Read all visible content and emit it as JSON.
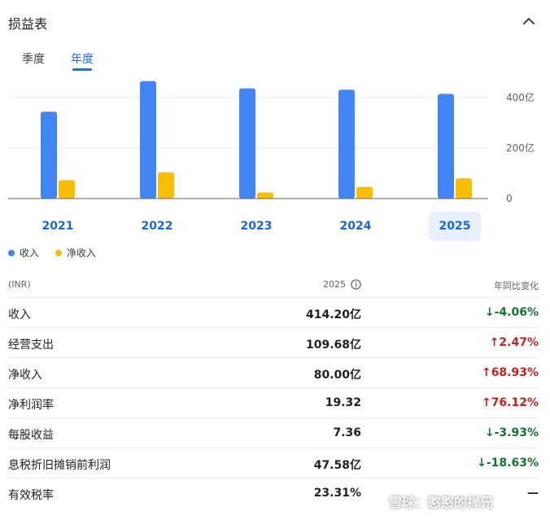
{
  "header": {
    "title": "损益表",
    "collapse_icon": "chevron-up-icon"
  },
  "tabs": [
    {
      "label": "季度",
      "selected": false
    },
    {
      "label": "年度",
      "selected": true
    }
  ],
  "chart_data": {
    "type": "bar",
    "categories": [
      "2021",
      "2022",
      "2023",
      "2024",
      "2025"
    ],
    "series": [
      {
        "name": "收入",
        "color": "#4285f4",
        "values": [
          344,
          465,
          436,
          431,
          414.2
        ]
      },
      {
        "name": "净收入",
        "color": "#fbbc04",
        "values": [
          73,
          104,
          24,
          46,
          80.0
        ]
      }
    ],
    "ylim": [
      0,
      480
    ],
    "yticks": [
      {
        "value": 400,
        "label": "400亿"
      },
      {
        "value": 200,
        "label": "200亿"
      },
      {
        "value": 0,
        "label": "0"
      }
    ],
    "selected_category": "2025",
    "grid": true,
    "legend_position": "bottom-left"
  },
  "legend": [
    {
      "label": "收入",
      "color": "#4285f4"
    },
    {
      "label": "净收入",
      "color": "#fbbc04"
    }
  ],
  "table": {
    "header": {
      "label": "(INR)",
      "year": "2025",
      "change": "年同比变化"
    },
    "rows": [
      {
        "label": "收入",
        "value": "414.20亿",
        "change": "-4.06%",
        "direction": "down"
      },
      {
        "label": "经营支出",
        "value": "109.68亿",
        "change": "2.47%",
        "direction": "up"
      },
      {
        "label": "净收入",
        "value": "80.00亿",
        "change": "68.93%",
        "direction": "up"
      },
      {
        "label": "净利润率",
        "value": "19.32",
        "change": "76.12%",
        "direction": "up"
      },
      {
        "label": "每股收益",
        "value": "7.36",
        "change": "-3.93%",
        "direction": "down"
      },
      {
        "label": "息税折旧摊销前利润",
        "value": "47.58亿",
        "change": "-18.63%",
        "direction": "down"
      },
      {
        "label": "有效税率",
        "value": "23.31%",
        "change": "—",
        "direction": "none"
      }
    ]
  },
  "watermark": "雪球：憨憨的禅兄"
}
